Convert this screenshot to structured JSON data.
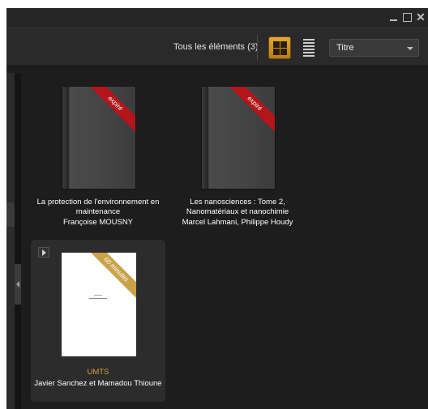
{
  "toolbar": {
    "count_label": "Tous les éléments  (3)",
    "view_grid_icon": "grid-view-icon",
    "view_list_icon": "list-view-icon",
    "sort_value": "Titre"
  },
  "window_controls": {
    "minimize_icon": "minimize-icon",
    "maximize_icon": "maximize-icon",
    "close_label": "✕"
  },
  "colors": {
    "background": "#1d1d1d",
    "accent": "#d9a23a",
    "expired_ribbon": "#b3151a",
    "time_ribbon": "#c9a34a"
  },
  "books": [
    {
      "ribbon": "expiré",
      "title_line1": "La protection de l'environnement en",
      "title_line2": "maintenance",
      "author": "Françoise MOUSNY"
    },
    {
      "ribbon": "expiré",
      "title_line1": "Les nanosciences : Tome 2,",
      "title_line2": "Nanomatériaux et nanochimie",
      "author": "Marcel Lahmani, Philippe Houdy"
    },
    {
      "ribbon": "60 minutes",
      "title_line1": "UMTS",
      "author": "Javier Sanchez et Mamadou Thioune"
    }
  ]
}
